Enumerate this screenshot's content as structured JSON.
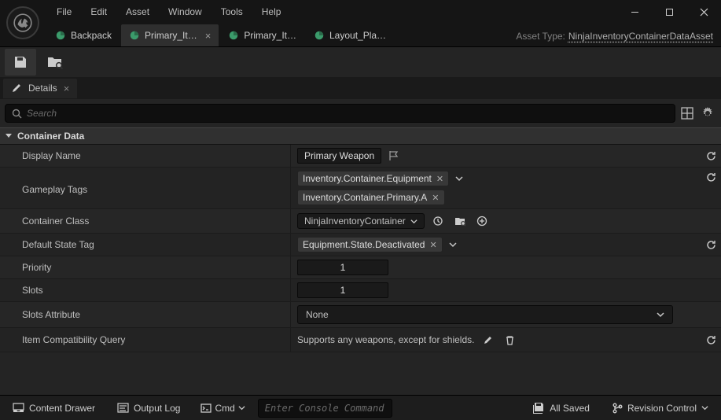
{
  "menu": {
    "items": [
      "File",
      "Edit",
      "Asset",
      "Window",
      "Tools",
      "Help"
    ]
  },
  "tabs": [
    {
      "label": "Backpack",
      "active": false,
      "closable": false
    },
    {
      "label": "Primary_It…",
      "active": true,
      "closable": true
    },
    {
      "label": "Primary_It…",
      "active": false,
      "closable": false
    },
    {
      "label": "Layout_Pla…",
      "active": false,
      "closable": false
    }
  ],
  "asset_type": {
    "prefix": "Asset Type:",
    "name": "NinjaInventoryContainerDataAsset"
  },
  "details": {
    "tab_label": "Details",
    "search_placeholder": "Search"
  },
  "category": {
    "label": "Container Data"
  },
  "props": {
    "display_name": {
      "label": "Display Name",
      "value": "Primary Weapon"
    },
    "gameplay_tags": {
      "label": "Gameplay Tags",
      "tags": [
        "Inventory.Container.Equipment",
        "Inventory.Container.Primary.A"
      ]
    },
    "container_class": {
      "label": "Container Class",
      "value": "NinjaInventoryContainer"
    },
    "default_state_tag": {
      "label": "Default State Tag",
      "value": "Equipment.State.Deactivated"
    },
    "priority": {
      "label": "Priority",
      "value": "1"
    },
    "slots": {
      "label": "Slots",
      "value": "1"
    },
    "slots_attribute": {
      "label": "Slots Attribute",
      "value": "None"
    },
    "item_compat": {
      "label": "Item Compatibility Query",
      "value": "Supports any weapons, except for shields."
    }
  },
  "bottom": {
    "content_drawer": "Content Drawer",
    "output_log": "Output Log",
    "cmd_label": "Cmd",
    "cmd_placeholder": "Enter Console Command",
    "all_saved": "All Saved",
    "revision": "Revision Control"
  }
}
